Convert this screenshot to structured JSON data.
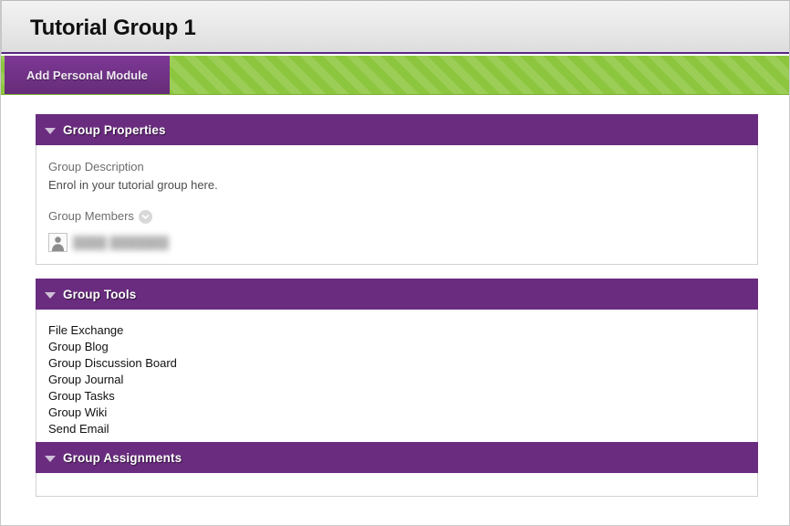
{
  "header": {
    "title": "Tutorial Group 1"
  },
  "action_bar": {
    "add_personal_module_label": "Add Personal Module"
  },
  "modules": {
    "group_properties": {
      "title": "Group Properties",
      "collapse_icon": "triangle-down-icon",
      "description_label": "Group Description",
      "description_text": "Enrol in your tutorial group here.",
      "members_label": "Group Members",
      "members_toggle_icon": "chevron-down-circle-icon",
      "members": [
        {
          "avatar_icon": "user-avatar-icon",
          "name": "████ ███████"
        }
      ]
    },
    "group_tools": {
      "title": "Group Tools",
      "collapse_icon": "triangle-down-icon",
      "tools": [
        "File Exchange",
        "Group Blog",
        "Group Discussion Board",
        "Group Journal",
        "Group Tasks",
        "Group Wiki",
        "Send Email"
      ]
    },
    "group_assignments": {
      "title": "Group Assignments",
      "collapse_icon": "triangle-down-icon"
    }
  },
  "colors": {
    "purple": "#6a2c7f",
    "purple_tab": "#74338a",
    "green": "#8cc63e",
    "header_gray": "#eaeaea",
    "panel_border": "#d3d3d3"
  }
}
